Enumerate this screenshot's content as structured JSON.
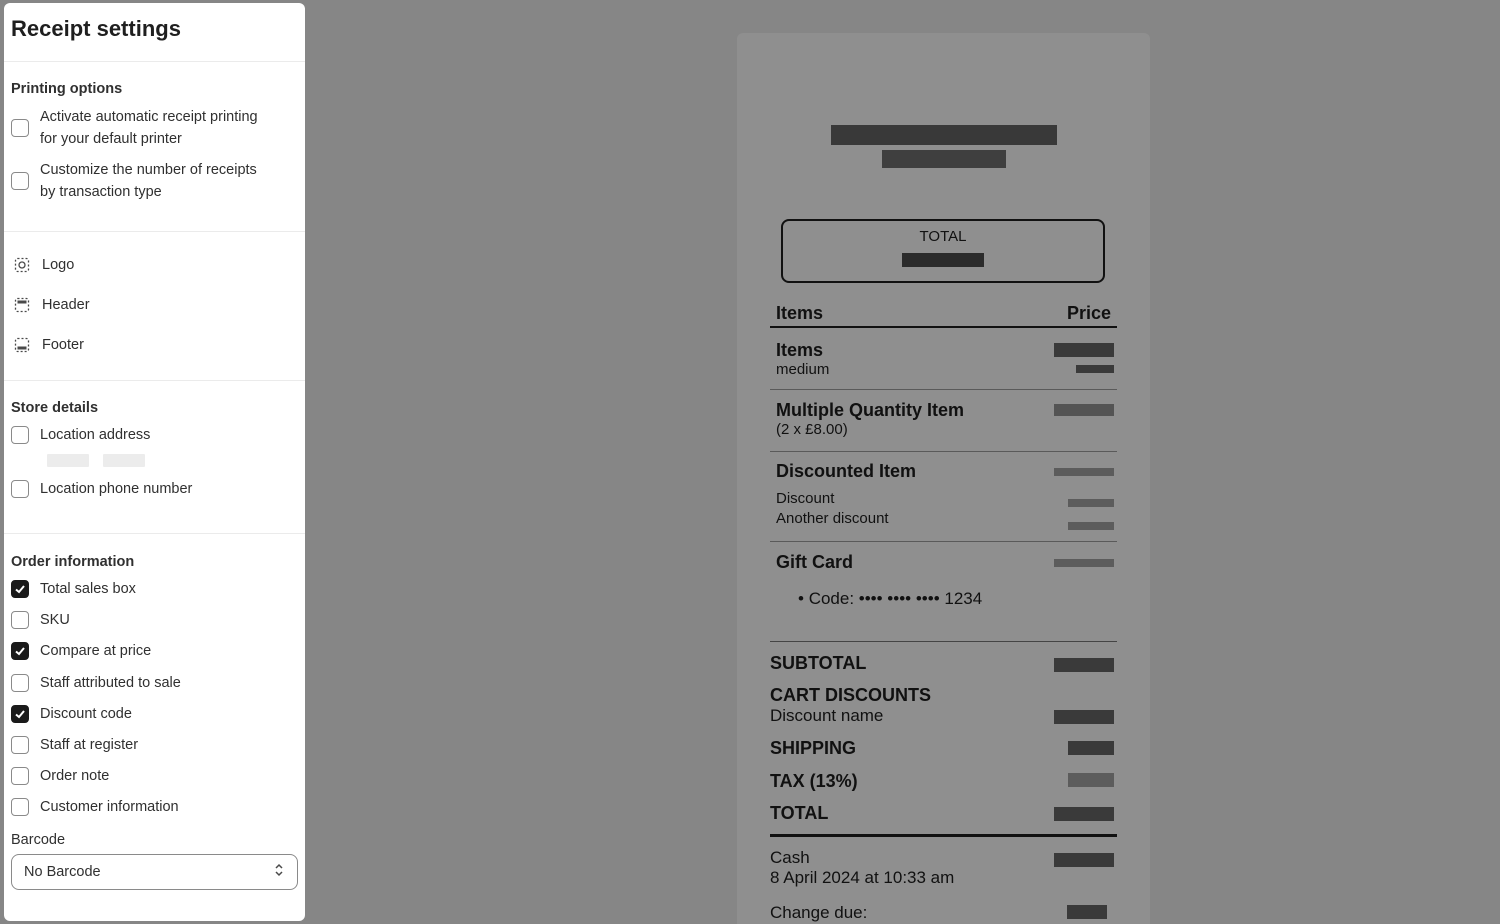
{
  "sidebar": {
    "title": "Receipt settings",
    "printing": {
      "heading": "Printing options",
      "options": [
        {
          "label_line1": "Activate automatic receipt printing",
          "label_line2": "for your default printer",
          "checked": false
        },
        {
          "label_line1": "Customize the number of receipts",
          "label_line2": "by transaction type",
          "checked": false
        }
      ]
    },
    "nav": [
      {
        "label": "Logo",
        "icon": "logo-icon"
      },
      {
        "label": "Header",
        "icon": "header-icon"
      },
      {
        "label": "Footer",
        "icon": "footer-icon"
      }
    ],
    "store": {
      "heading": "Store details",
      "location_address": "Location address",
      "location_phone": "Location phone number"
    },
    "order": {
      "heading": "Order information",
      "options": [
        {
          "label": "Total sales box",
          "checked": true
        },
        {
          "label": "SKU",
          "checked": false
        },
        {
          "label": "Compare at price",
          "checked": true
        },
        {
          "label": "Staff attributed to sale",
          "checked": false
        },
        {
          "label": "Discount code",
          "checked": true
        },
        {
          "label": "Staff at register",
          "checked": false
        },
        {
          "label": "Order note",
          "checked": false
        },
        {
          "label": "Customer information",
          "checked": false
        }
      ]
    },
    "barcode": {
      "label": "Barcode",
      "selected": "No Barcode"
    }
  },
  "receipt": {
    "total_box_label": "TOTAL",
    "col_items": "Items",
    "col_price": "Price",
    "items": [
      {
        "name": "Items",
        "sub": "medium"
      },
      {
        "name": "Multiple Quantity Item",
        "sub": "(2 x £8.00)"
      },
      {
        "name": "Discounted Item",
        "sub1": "Discount",
        "sub2": "Another discount"
      },
      {
        "name": "Gift Card",
        "code": "Code: •••• •••• •••• 1234"
      }
    ],
    "subtotal": "SUBTOTAL",
    "cart_discounts": "CART DISCOUNTS",
    "discount_name": "Discount name",
    "shipping": "SHIPPING",
    "tax": "TAX (13%)",
    "total": "TOTAL",
    "payment_method": "Cash",
    "payment_date": "8 April 2024 at 10:33 am",
    "change_due": "Change due:"
  }
}
